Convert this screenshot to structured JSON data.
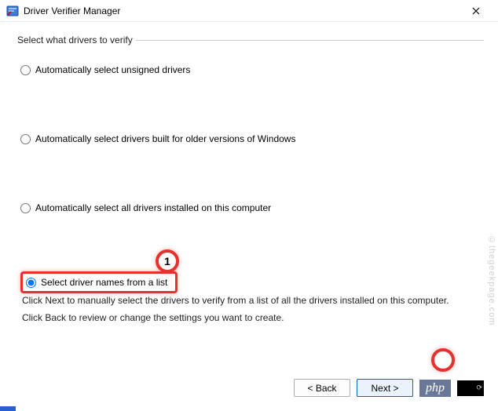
{
  "window": {
    "title": "Driver Verifier Manager"
  },
  "group": {
    "legend": "Select what drivers to verify",
    "options": [
      {
        "label": "Automatically select unsigned drivers",
        "checked": false
      },
      {
        "label": "Automatically select drivers built for older versions of Windows",
        "checked": false
      },
      {
        "label": "Automatically select all drivers installed on this computer",
        "checked": false
      },
      {
        "label": "Select driver names from a list",
        "checked": true
      }
    ]
  },
  "callouts": {
    "one": "1"
  },
  "hints": {
    "line1": "Click Next to manually select the drivers to verify from a list of all the drivers installed on this computer.",
    "line2": "Click Back to review or change the settings you want to create."
  },
  "buttons": {
    "back": "< Back",
    "next": "Next >"
  },
  "overlay": {
    "php": "php",
    "watermark": "©thegeekpage.com"
  }
}
